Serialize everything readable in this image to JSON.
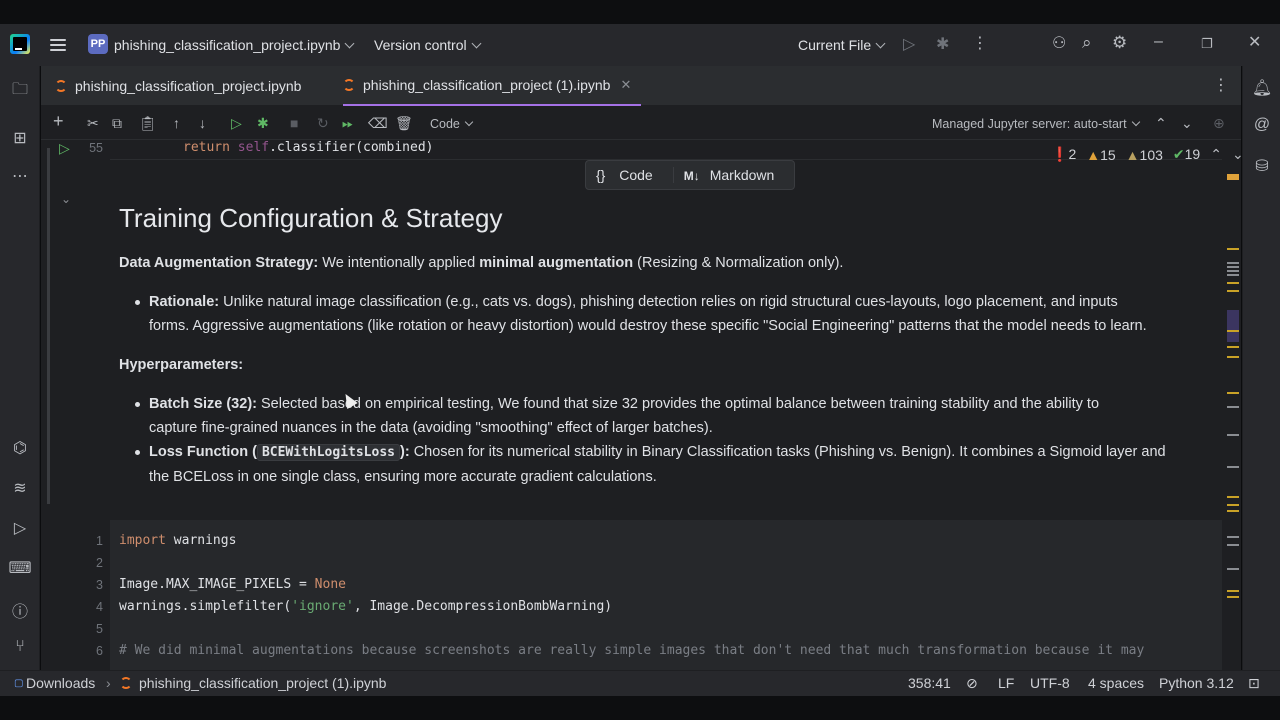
{
  "titlebar": {
    "project_badge": "PP",
    "project_name": "phishing_classification_project.ipynb",
    "version_control": "Version control",
    "run_config": "Current File"
  },
  "tabs": [
    {
      "label": "phishing_classification_project.ipynb",
      "active": false
    },
    {
      "label": "phishing_classification_project (1).ipynb",
      "active": true
    }
  ],
  "toolbar": {
    "cell_type": "Code",
    "server": "Managed Jupyter server: auto-start"
  },
  "prev_cell": {
    "line_number": "55",
    "code_return": "return",
    "code_self": "self",
    "code_rest": ".classifier(combined)"
  },
  "cell_popup": {
    "code": "Code",
    "markdown": "Markdown",
    "markdown_prefix": "M↓"
  },
  "inspections": {
    "errors": "2",
    "warnings": "15",
    "weak_warnings": "103",
    "ok": "19"
  },
  "markdown": {
    "heading": "Training Configuration & Strategy",
    "aug_label": "Data Augmentation Strategy:",
    "aug_text1": " We intentionally applied ",
    "aug_bold": "minimal augmentation",
    "aug_text2": " (Resizing & Normalization only).",
    "rationale_label": "Rationale:",
    "rationale_line1": " Unlike natural image classification (e.g., cats vs. dogs), phishing detection relies on rigid structural cues-layouts, logo placement, and inputs",
    "rationale_line2": "forms. Aggressive augmentations (like rotation or heavy distortion) would destroy these specific \"Social Engineering\" patterns that the model needs to learn.",
    "hyper_label": "Hyperparameters:",
    "batch_label": "Batch Size (32):",
    "batch_line1": " Selected based on empirical testing, We found that size 32 provides the optimal balance between training stability and the ability to",
    "batch_line2": "capture fine-grained nuances in the data (avoiding \"smoothing\" effect of larger batches).",
    "loss_label_pre": "Loss Function (",
    "loss_code": "BCEWithLogitsLoss",
    "loss_label_post": "):",
    "loss_line1": " Chosen for its numerical stability in Binary Classification tasks (Phishing vs. Benign). It combines a Sigmoid layer and",
    "loss_line2": "the BCELoss in one single class, ensuring more accurate gradient calculations."
  },
  "code_cell": {
    "lines": [
      {
        "n": "1",
        "kw": "import",
        "rest": " warnings"
      },
      {
        "n": "2"
      },
      {
        "n": "3",
        "pre": "Image.MAX_IMAGE_PIXELS = ",
        "kw": "None"
      },
      {
        "n": "4",
        "pre": "warnings.simplefilter(",
        "str": "'ignore'",
        "rest": ", Image.DecompressionBombWarning)"
      },
      {
        "n": "5"
      },
      {
        "n": "6",
        "cmt": "# We did minimal augmentations because screenshots are really simple images that don't need that much transformation because it may"
      }
    ]
  },
  "statusbar": {
    "breadcrumb_root": "Downloads",
    "breadcrumb_file": "phishing_classification_project (1).ipynb",
    "position": "358:41",
    "line_sep": "LF",
    "encoding": "UTF-8",
    "indent": "4 spaces",
    "interpreter": "Python 3.12"
  }
}
